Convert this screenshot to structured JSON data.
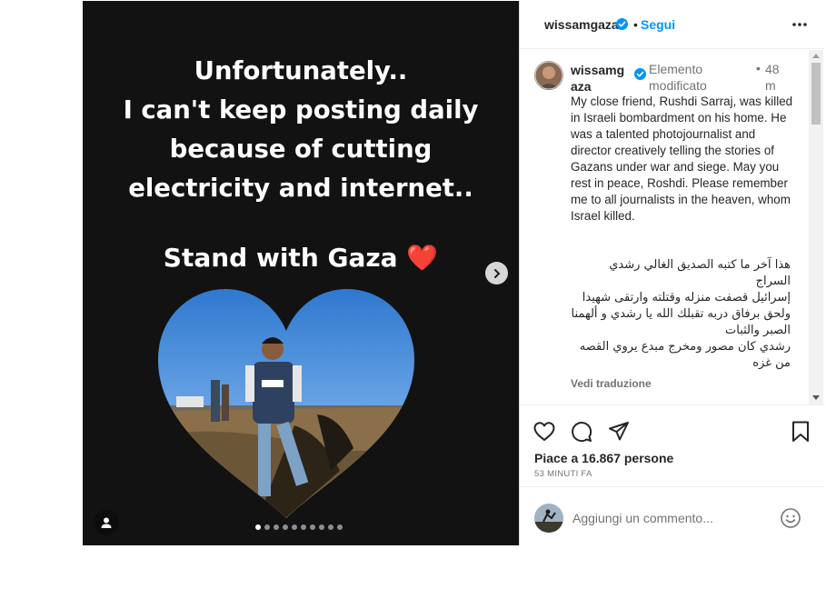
{
  "media": {
    "headline_lines": [
      "Unfortunately..",
      "I can't keep posting daily",
      "because of cutting",
      "electricity and internet.."
    ],
    "stand_text": "Stand with Gaza",
    "stand_emoji": "❤️",
    "carousel": {
      "total_slides": 10,
      "current_slide": 1
    },
    "icons": {
      "next": "chevron-right-icon",
      "tag": "person-tag-icon"
    }
  },
  "header": {
    "username": "wissamgaza",
    "dot": "•",
    "follow_label": "Segui",
    "more_icon": "more-options-icon"
  },
  "caption": {
    "username": "wissamgaza",
    "edited_label": "Elemento modificato",
    "dot": "•",
    "time": "48 m",
    "text": "My close friend, Rushdi Sarraj, was killed in Israeli bombardment on his home. He was a talented photojournalist and director creatively telling the stories of Gazans under war and siege. May you rest in peace, Roshdi. Please remember me to all journalists in the heaven, whom Israel killed.",
    "arabic_lines": [
      "هذا آخر ما كتبه الصديق الغالي رشدي السراج",
      "إسرائيل قصفت منزله وقتلته وارتقى شهيدا",
      "ولحق برفاق دربه تقبلك الله يا رشدي و ألهمنا الصبر والثبات",
      "رشدي كان مصور ومخرج مبدع يروي القصه من غزه"
    ],
    "see_translation": "Vedi traduzione"
  },
  "actions": {
    "likes_text": "Piace a 16.867 persone",
    "time_ago": "53 MINUTI FA",
    "icons": [
      "heart-icon",
      "comment-icon",
      "share-icon",
      "save-icon"
    ]
  },
  "add_comment": {
    "placeholder": "Aggiungi un commento...",
    "emoji_icon": "emoji-icon"
  },
  "colors": {
    "accent": "#0095f6",
    "verified": "#0095f6",
    "media_bg": "#121212",
    "heart_emoji": "#e8202f",
    "muted": "#737373"
  }
}
